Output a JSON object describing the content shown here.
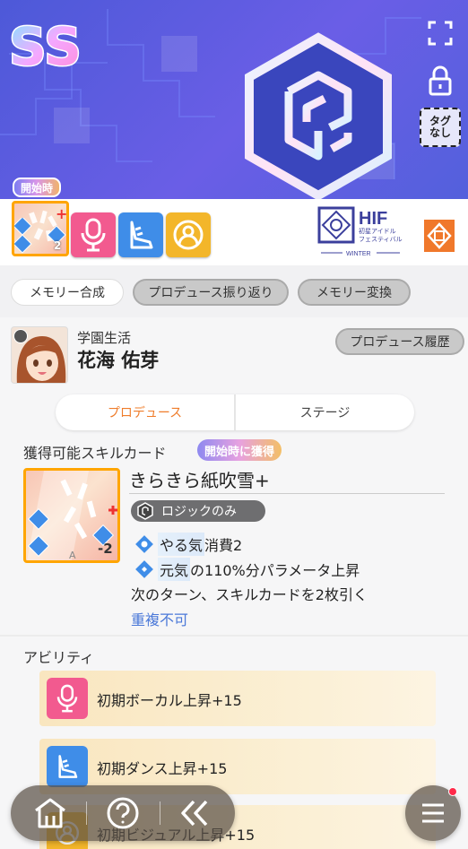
{
  "banner": {
    "rank": "SS",
    "tag_button": {
      "line1": "タグ",
      "line2": "なし"
    }
  },
  "strip": {
    "start_badge": "開始時",
    "card_cost": "2",
    "hif_logo": {
      "title": "HIF",
      "subtitle_line1": "初星アイドル",
      "subtitle_line2": "フェスティバル",
      "season": "WINTER"
    }
  },
  "actions": {
    "memory_compose": "メモリー合成",
    "produce_review": "プロデュース振り返り",
    "memory_convert": "メモリー変換"
  },
  "character": {
    "school": "学園生活",
    "name": "花海 佑芽",
    "history_button": "プロデュース履歴"
  },
  "tabs": {
    "produce": "プロデュース",
    "stage": "ステージ"
  },
  "skill": {
    "section_label": "獲得可能スキルカード",
    "acquire_badge": "開始時に獲得",
    "name": "きらきら紙吹雪+",
    "cost": "-2",
    "card_letter": "A",
    "logic_badge": "ロジックのみ",
    "effect1_hl": "やる気",
    "effect1_rest": "消費2",
    "effect2_hl": "元気",
    "effect2_rest": "の110%分パラメータ上昇",
    "effect3": "次のターン、スキルカードを2枚引く",
    "no_dup": "重複不可"
  },
  "abilities": {
    "section_label": "アビリティ",
    "items": [
      {
        "label": "初期ボーカル上昇+15"
      },
      {
        "label": "初期ダンス上昇+15"
      },
      {
        "label": "初期ビジュアル上昇+15"
      }
    ]
  },
  "colors": {
    "banner": "#5360dc",
    "accent_orange": "#ef7c2a",
    "vocal_pink": "#f25a8f",
    "dance_blue": "#3f8de8",
    "visual_yellow": "#f3b62a",
    "link_blue": "#4a78d8"
  }
}
